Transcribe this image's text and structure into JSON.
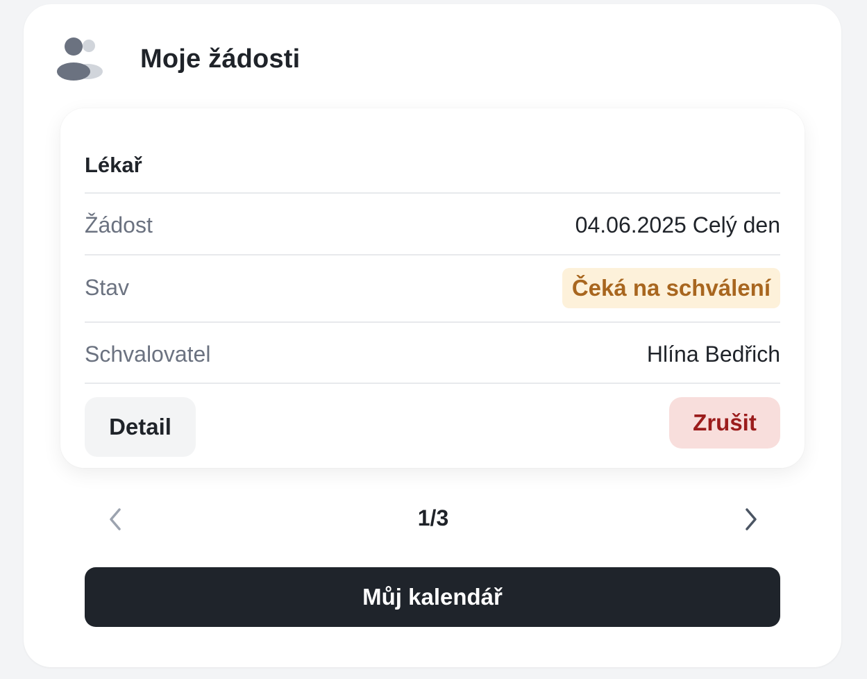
{
  "header": {
    "icon": "people-icon",
    "title": "Moje žádosti"
  },
  "request": {
    "type": "Lékař",
    "rows": [
      {
        "label": "Žádost",
        "value": "04.06.2025 Celý den"
      },
      {
        "label": "Stav",
        "value": "Čeká na schválení"
      },
      {
        "label": "Schvalovatel",
        "value": "Hlína Bedřich"
      }
    ],
    "detail_label": "Detail",
    "cancel_label": "Zrušit"
  },
  "pager": {
    "current": "1/3",
    "prev_icon": "chevron-left-icon",
    "next_icon": "chevron-right-icon"
  },
  "calendar_button": "Můj kalendář",
  "colors": {
    "status_bg": "#fdf1da",
    "status_text": "#a8661f",
    "cancel_bg": "#f8dedc",
    "cancel_text": "#9b1c1c",
    "primary_button": "#1f242b"
  }
}
